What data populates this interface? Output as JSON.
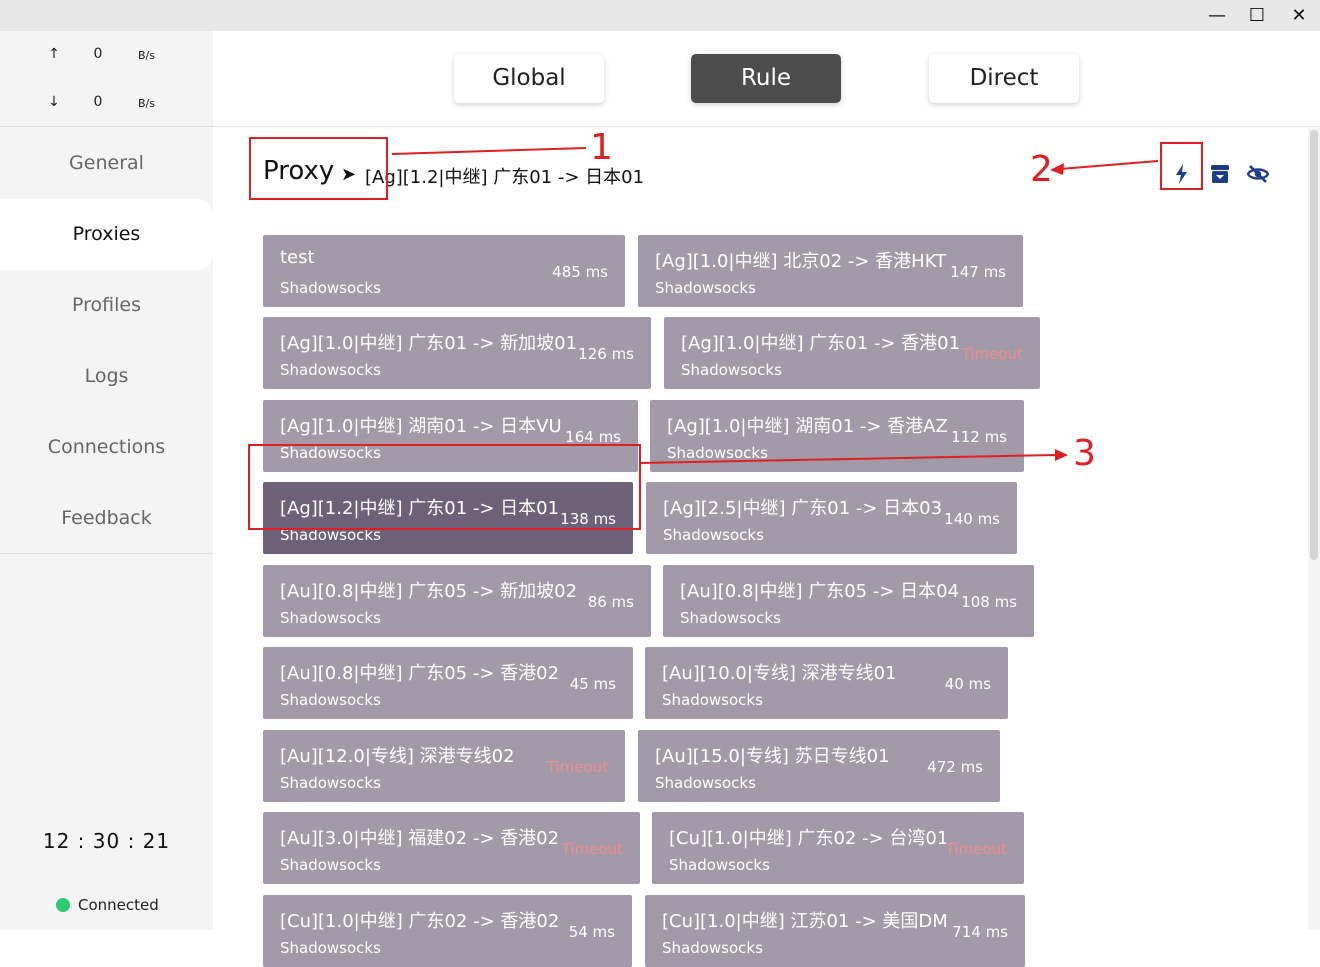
{
  "window": {
    "minimize": "—",
    "maximize": "☐",
    "close": "✕"
  },
  "traffic": {
    "up_arrow": "↑",
    "up_value": "0",
    "up_unit": "B/s",
    "down_arrow": "↓",
    "down_value": "0",
    "down_unit": "B/s"
  },
  "nav": {
    "items": [
      {
        "label": "General"
      },
      {
        "label": "Proxies"
      },
      {
        "label": "Profiles"
      },
      {
        "label": "Logs"
      },
      {
        "label": "Connections"
      },
      {
        "label": "Feedback"
      }
    ],
    "active": "Proxies"
  },
  "clock": "12 : 30 : 21",
  "status": "Connected",
  "modes": {
    "global": "Global",
    "rule": "Rule",
    "direct": "Direct",
    "active": "Rule"
  },
  "group": {
    "name": "Proxy",
    "arrow": "➤",
    "current": "[Ag][1.2|中继] 广东01 -> 日本01"
  },
  "toolbar": {
    "icons": [
      "lightning-icon",
      "archive-icon",
      "eye-off-icon"
    ]
  },
  "proxies": [
    {
      "name": "test",
      "type": "Shadowsocks",
      "delay": "485 ms"
    },
    {
      "name": "[Ag][1.0|中继] 北京02 -> 香港HKT",
      "type": "Shadowsocks",
      "delay": "147 ms"
    },
    {
      "name": "[Ag][1.0|中继] 广东01 -> 新加坡01",
      "type": "Shadowsocks",
      "delay": "126 ms"
    },
    {
      "name": "[Ag][1.0|中继] 广东01 -> 香港01",
      "type": "Shadowsocks",
      "delay": "Timeout"
    },
    {
      "name": "[Ag][1.0|中继] 湖南01 -> 日本VU",
      "type": "Shadowsocks",
      "delay": "164 ms"
    },
    {
      "name": "[Ag][1.0|中继] 湖南01 -> 香港AZ",
      "type": "Shadowsocks",
      "delay": "112 ms"
    },
    {
      "name": "[Ag][1.2|中继] 广东01 -> 日本01",
      "type": "Shadowsocks",
      "delay": "138 ms",
      "selected": true
    },
    {
      "name": "[Ag][2.5|中继] 广东01 -> 日本03",
      "type": "Shadowsocks",
      "delay": "140 ms"
    },
    {
      "name": "[Au][0.8|中继] 广东05 -> 新加坡02",
      "type": "Shadowsocks",
      "delay": "86 ms"
    },
    {
      "name": "[Au][0.8|中继] 广东05 -> 日本04",
      "type": "Shadowsocks",
      "delay": "108 ms"
    },
    {
      "name": "[Au][0.8|中继] 广东05 -> 香港02",
      "type": "Shadowsocks",
      "delay": "45 ms"
    },
    {
      "name": "[Au][10.0|专线] 深港专线01",
      "type": "Shadowsocks",
      "delay": "40 ms"
    },
    {
      "name": "[Au][12.0|专线] 深港专线02",
      "type": "Shadowsocks",
      "delay": "Timeout"
    },
    {
      "name": "[Au][15.0|专线] 苏日专线01",
      "type": "Shadowsocks",
      "delay": "472 ms"
    },
    {
      "name": "[Au][3.0|中继] 福建02 -> 香港02",
      "type": "Shadowsocks",
      "delay": "Timeout"
    },
    {
      "name": "[Cu][1.0|中继] 广东02 -> 台湾01",
      "type": "Shadowsocks",
      "delay": "Timeout"
    },
    {
      "name": "[Cu][1.0|中继] 广东02 -> 香港02",
      "type": "Shadowsocks",
      "delay": "54 ms"
    },
    {
      "name": "[Cu][1.0|中继] 江苏01 -> 美国DM",
      "type": "Shadowsocks",
      "delay": "714 ms"
    }
  ],
  "annotations": {
    "label1": "1",
    "label2": "2",
    "label3": "3",
    "color": "#e02020"
  },
  "colors": {
    "card": "#a29aa8",
    "card_selected": "#6e6078",
    "timeout": "#f08c8c",
    "mode_active": "#4d4d4d",
    "icon_blue": "#1f3c88",
    "connected_dot": "#2ecc71"
  }
}
